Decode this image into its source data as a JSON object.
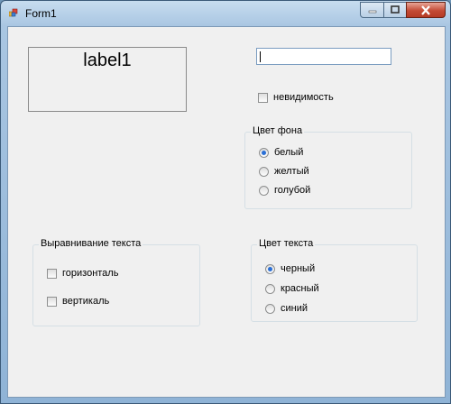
{
  "window": {
    "title": "Form1"
  },
  "label1": {
    "text": "label1"
  },
  "textbox": {
    "value": ""
  },
  "invisibility": {
    "label": "невидимость",
    "checked": false
  },
  "bg_group": {
    "title": "Цвет фона",
    "options": [
      {
        "label": "белый",
        "checked": true
      },
      {
        "label": "желтый",
        "checked": false
      },
      {
        "label": "голубой",
        "checked": false
      }
    ]
  },
  "align_group": {
    "title": "Выравнивание текста",
    "options": [
      {
        "label": "горизонталь",
        "checked": false
      },
      {
        "label": "вертикаль",
        "checked": false
      }
    ]
  },
  "text_color_group": {
    "title": "Цвет текста",
    "options": [
      {
        "label": "черный",
        "checked": true
      },
      {
        "label": "красный",
        "checked": false
      },
      {
        "label": "синий",
        "checked": false
      }
    ]
  }
}
